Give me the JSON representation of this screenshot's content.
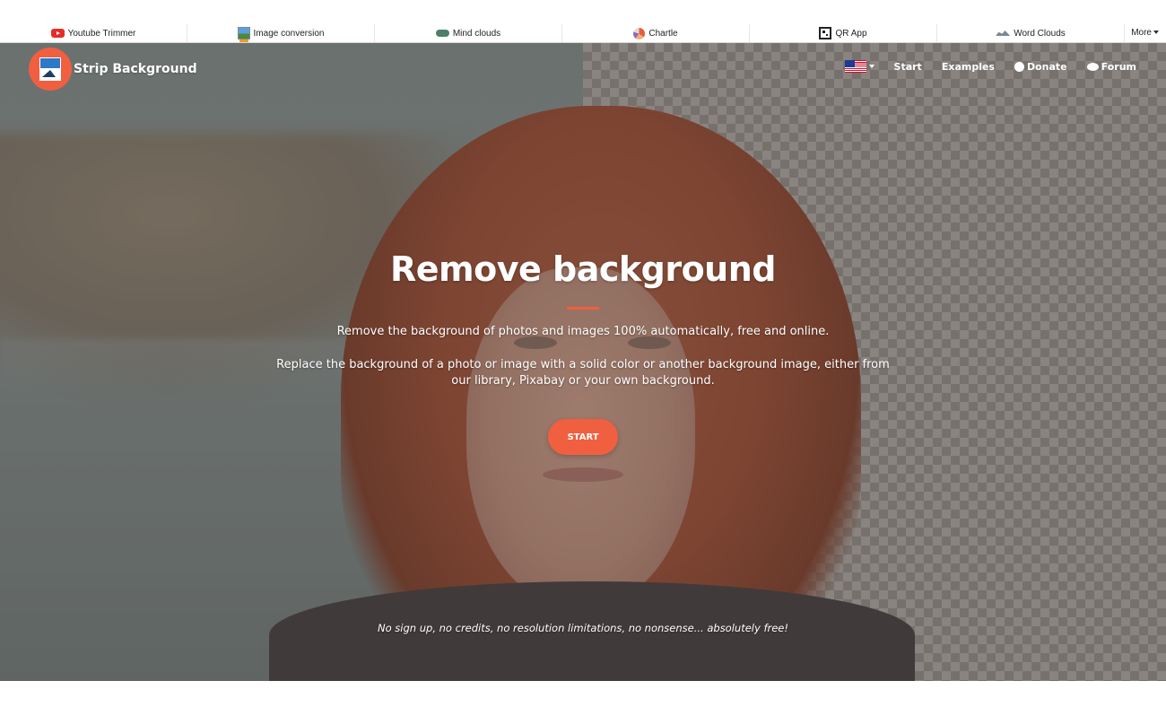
{
  "toolsbar": {
    "items": [
      {
        "label": "Youtube Trimmer",
        "icon": "youtube-icon"
      },
      {
        "label": "Image conversion",
        "icon": "image-conversion-icon"
      },
      {
        "label": "Mind clouds",
        "icon": "mind-clouds-icon"
      },
      {
        "label": "Chartle",
        "icon": "pie-chart-icon"
      },
      {
        "label": "QR App",
        "icon": "qr-code-icon"
      },
      {
        "label": "Word Clouds",
        "icon": "word-clouds-icon"
      }
    ],
    "more_label": "More"
  },
  "navbar": {
    "brand": "Strip Background",
    "language_icon": "uk-flag-icon",
    "links": {
      "start": "Start",
      "examples": "Examples",
      "donate": "Donate",
      "forum": "Forum"
    }
  },
  "hero": {
    "title": "Remove background",
    "lead1": "Remove the background of photos and images 100% automatically, free and online.",
    "lead2": "Replace the background of a photo or image with a solid color or another background image, either from our library, Pixabay or your own background.",
    "start_button": "START",
    "tagline": "No sign up, no credits, no resolution limitations, no nonsense... absolutely free!"
  },
  "colors": {
    "accent": "#f05f40",
    "text_on_hero": "#ffffff"
  }
}
